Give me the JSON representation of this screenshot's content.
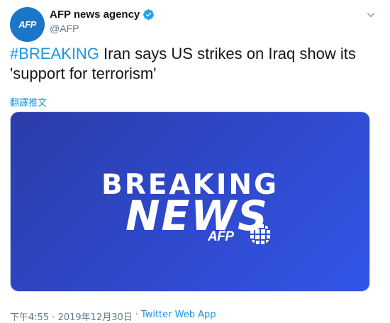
{
  "author": {
    "display_name": "AFP news agency",
    "handle": "@AFP",
    "avatar_text": "AFP",
    "verified": true
  },
  "tweet": {
    "hashtag": "#BREAKING",
    "text": " Iran says US strikes on Iraq show its 'support for terrorism'",
    "translate_label": "翻譯推文"
  },
  "media": {
    "line1": "BREAKING",
    "line2": "NEWS",
    "logo": "AFP"
  },
  "meta": {
    "timestamp": "下午4:55 · 2019年12月30日",
    "separator": "·",
    "source": "Twitter Web App"
  },
  "colors": {
    "accent": "#1b95e0",
    "avatar_bg": "#1b77c6",
    "media_bg": "#2e47c7"
  },
  "icons": [
    "verified-icon",
    "caret-down-icon",
    "afp-globe-icon"
  ]
}
